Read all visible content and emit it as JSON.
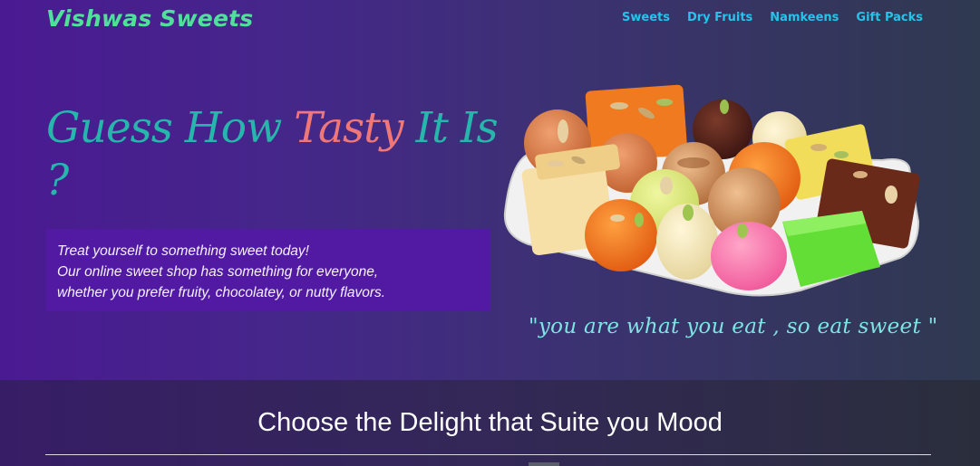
{
  "brand": {
    "name": "Vishwas Sweets"
  },
  "nav": {
    "items": [
      "Sweets",
      "Dry Fruits",
      "Namkeens",
      "Gift Packs"
    ]
  },
  "hero": {
    "headline_part1": "Guess How ",
    "headline_accent": "Tasty",
    "headline_part2": " It Is",
    "headline_line2": "?",
    "description": [
      "Treat yourself to something sweet today!",
      "Our online sweet shop has something for everyone,",
      "whether you prefer fruity, chocolatey, or nutty flavors."
    ],
    "quote": "\"you are what you eat , so eat sweet \""
  },
  "section": {
    "title": "Choose the Delight that Suite you Mood"
  },
  "colors": {
    "brand": "#4fe09a",
    "nav_link": "#27c3ea",
    "headline": "#27b6ac",
    "accent": "#f07777",
    "quote": "#7fe3e3"
  }
}
